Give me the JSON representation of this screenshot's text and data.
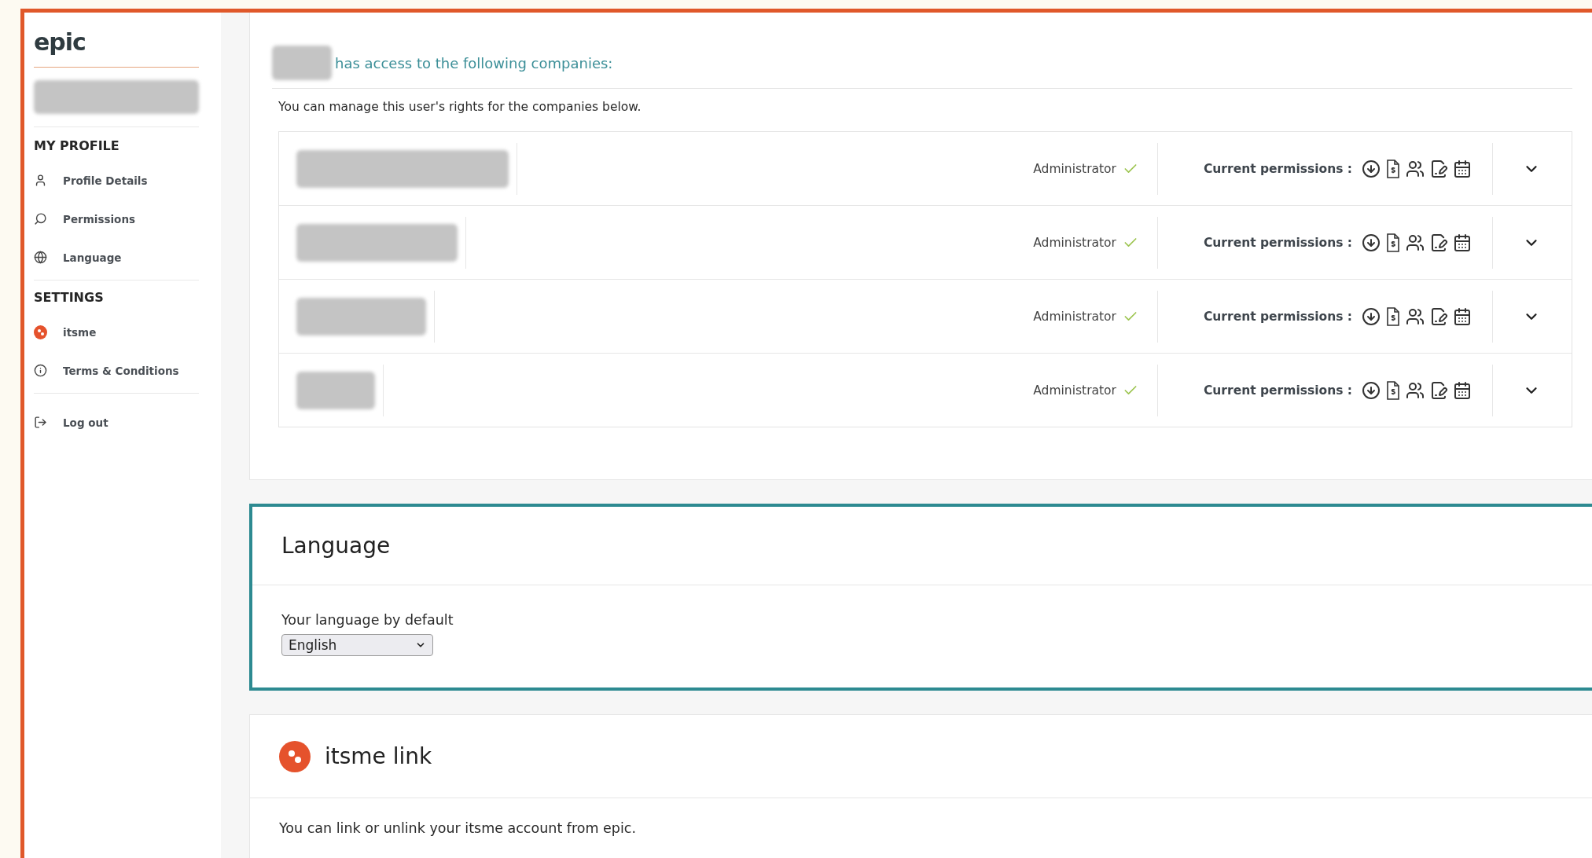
{
  "logo": "epic",
  "sidebar": {
    "sections": [
      {
        "title": "MY PROFILE",
        "items": [
          {
            "label": "Profile Details"
          },
          {
            "label": "Permissions"
          },
          {
            "label": "Language"
          }
        ]
      },
      {
        "title": "SETTINGS",
        "items": [
          {
            "label": "itsme"
          },
          {
            "label": "Terms & Conditions"
          }
        ]
      }
    ],
    "footer_item": {
      "label": "Log out"
    }
  },
  "access": {
    "heading": "has access to the following companies:",
    "subtitle": "You can manage this user's rights for the companies below.",
    "companies": [
      {
        "role": "Administrator",
        "permissions_label": "Current permissions :",
        "expanded": false
      },
      {
        "role": "Administrator",
        "permissions_label": "Current permissions :",
        "expanded": false
      },
      {
        "role": "Administrator",
        "permissions_label": "Current permissions :",
        "expanded": false
      },
      {
        "role": "Administrator",
        "permissions_label": "Current permissions :",
        "expanded": false
      }
    ]
  },
  "language": {
    "title": "Language",
    "field_label": "Your language by default",
    "value": "English"
  },
  "itsme": {
    "title": "itsme link",
    "text": "You can link or unlink your itsme account from epic."
  }
}
